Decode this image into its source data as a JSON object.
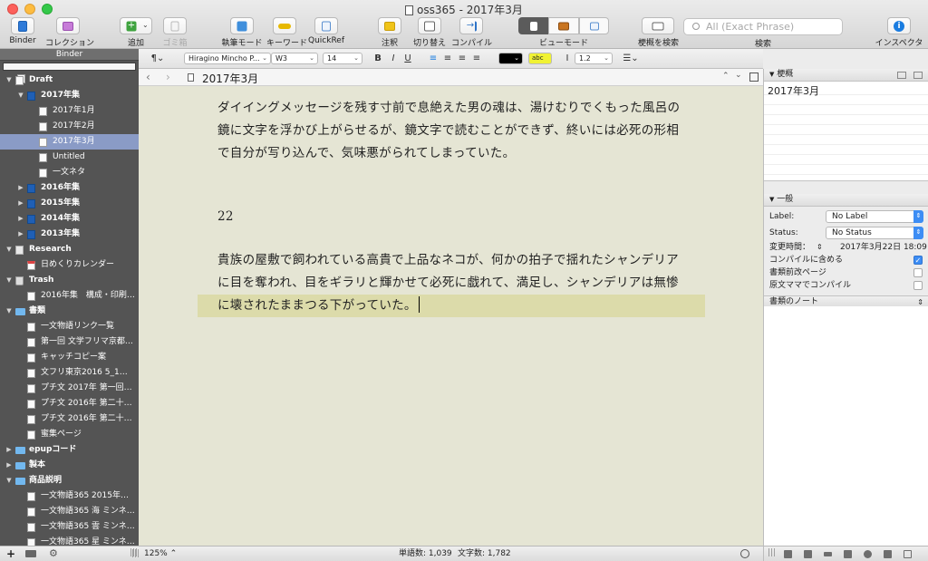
{
  "window": {
    "title": "oss365 - 2017年3月"
  },
  "toolbar": {
    "binder": "Binder",
    "collection": "コレクション",
    "add": "追加",
    "trash": "ゴミ箱",
    "composition_mode": "執筆モード",
    "keywords": "キーワード",
    "quickref": "QuickRef",
    "comments": "注釈",
    "toggle": "切り替え",
    "compile": "コンパイル",
    "view_mode": "ビューモード",
    "search_synopsis": "梗概を検索",
    "search_placeholder": "All (Exact Phrase)",
    "search": "検索",
    "inspector": "インスペクタ"
  },
  "binder": {
    "header": "Binder",
    "items": [
      {
        "label": "Draft",
        "type": "stack",
        "bold": true,
        "expanded": true
      },
      {
        "label": "2017年集",
        "type": "book",
        "bold": true,
        "expanded": true
      },
      {
        "label": "2017年1月",
        "type": "doc"
      },
      {
        "label": "2017年2月",
        "type": "doc"
      },
      {
        "label": "2017年3月",
        "type": "doc",
        "selected": true
      },
      {
        "label": "Untitled",
        "type": "doc"
      },
      {
        "label": "一文ネタ",
        "type": "doc"
      },
      {
        "label": "2016年集",
        "type": "book",
        "bold": true,
        "expanded": false
      },
      {
        "label": "2015年集",
        "type": "book",
        "bold": true,
        "expanded": false
      },
      {
        "label": "2014年集",
        "type": "book",
        "bold": true,
        "expanded": false
      },
      {
        "label": "2013年集",
        "type": "book",
        "bold": true,
        "expanded": false
      },
      {
        "label": "Research",
        "type": "research",
        "bold": true,
        "expanded": true
      },
      {
        "label": "日めくりカレンダー",
        "type": "cal"
      },
      {
        "label": "Trash",
        "type": "trash",
        "bold": true,
        "expanded": true
      },
      {
        "label": "2016年集　構成・印刷…",
        "type": "doc"
      },
      {
        "label": "書類",
        "type": "folder",
        "bold": true,
        "expanded": true
      },
      {
        "label": "一文物語リンク一覧",
        "type": "doc"
      },
      {
        "label": "第一回 文学フリマ京都…",
        "type": "doc"
      },
      {
        "label": "キャッチコピー案",
        "type": "doc"
      },
      {
        "label": "文フリ東京2016 5_1…",
        "type": "doc"
      },
      {
        "label": "プチ文 2017年 第一回…",
        "type": "doc"
      },
      {
        "label": "プチ文 2016年 第二十…",
        "type": "doc"
      },
      {
        "label": "プチ文 2016年 第二十…",
        "type": "doc"
      },
      {
        "label": "蜜集ページ",
        "type": "doc"
      },
      {
        "label": "epupコード",
        "type": "folder",
        "bold": true,
        "expanded": false
      },
      {
        "label": "製本",
        "type": "folder",
        "bold": true,
        "expanded": false
      },
      {
        "label": "商品説明",
        "type": "folder",
        "bold": true,
        "expanded": true
      },
      {
        "label": "一文物語365 2015年…",
        "type": "doc"
      },
      {
        "label": "一文物語365 海 ミンネ…",
        "type": "doc"
      },
      {
        "label": "一文物語365 雲 ミンネ…",
        "type": "doc"
      },
      {
        "label": "一文物語365 星 ミンネ…",
        "type": "doc"
      }
    ]
  },
  "format": {
    "font": "Hiragino Mincho P...",
    "weight": "W3",
    "size": "14",
    "highlight": "abc",
    "line_spacing": "1.2"
  },
  "editor": {
    "title": "2017年3月",
    "para1": "ダイイングメッセージを残す寸前で息絶えた男の魂は、湯けむりでくもった風呂の鏡に文字を浮かび上がらせるが、鏡文字で読むことができず、終いには必死の形相で自分が写り込んで、気味悪がられてしまっていた。",
    "number": "22",
    "para3_line1": "貴族の屋敷で飼われている高貴で上品なネコが、何かの拍子で揺れたシャンデリア",
    "para3_line2": "に目を奪われ、目をギラリと輝かせて必死に戯れて、満足し、シャンデリアは無惨",
    "para3_line3": "に壊されたままつる下がっていた。"
  },
  "footer": {
    "zoom": "125%",
    "words": "単語数: 1,039",
    "chars": "文字数: 1,782"
  },
  "inspector": {
    "synopsis_header": "梗概",
    "synopsis_text": "2017年3月",
    "general_header": "一般",
    "label_caption": "Label:",
    "label_value": "No Label",
    "status_caption": "Status:",
    "status_value": "No Status",
    "modified_caption": "変更時間：",
    "modified_value": "2017年3月22日 18:09",
    "include_compile": "コンパイルに含める",
    "page_break": "書類前改ページ",
    "compile_as_is": "原文ママでコンパイル",
    "notes_header": "書類のノート"
  }
}
